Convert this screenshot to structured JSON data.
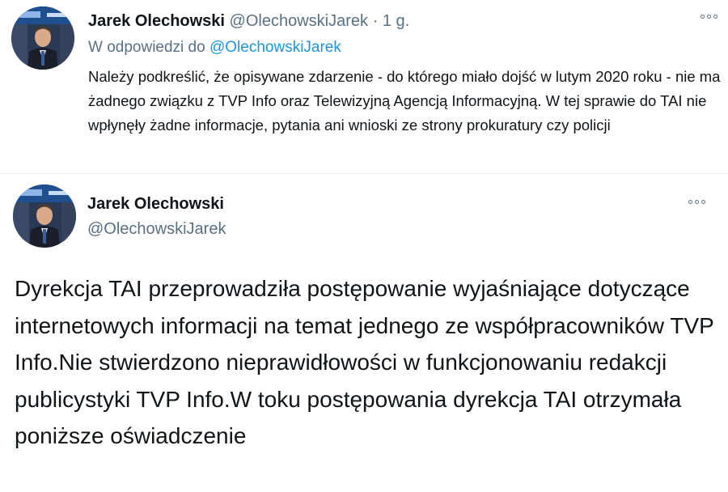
{
  "reply_tweet": {
    "author_name": "Jarek Olechowski",
    "author_handle": "@OlechowskiJarek",
    "separator": "·",
    "time": "1 g.",
    "reply_prefix": "W odpowiedzi do",
    "reply_mention": "@OlechowskiJarek",
    "text": "Należy podkreślić, że opisywane zdarzenie - do którego miało dojść w lutym 2020 roku - nie ma żadnego związku z TVP Info oraz Telewizyjną Agencją Informacyjną. W tej sprawie do TAI nie wpłynęły żadne informacje, pytania ani wnioski ze strony prokuratury czy policji",
    "more_icon": "more-horizontal-icon"
  },
  "main_tweet": {
    "author_name": "Jarek Olechowski",
    "author_handle": "@OlechowskiJarek",
    "text": "Dyrekcja TAI przeprowadziła postępowanie wyjaśniające dotyczące internetowych informacji na temat jednego ze współpracowników TVP Info.Nie stwierdzono nieprawidłowości w funkcjonowaniu redakcji publicystyki TVP Info.W toku postępowania dyrekcja TAI otrzymała poniższe oświadczenie",
    "more_icon": "more-horizontal-icon"
  },
  "colors": {
    "text_primary": "#0f1419",
    "text_secondary": "#5b7083",
    "link": "#1b95e0",
    "divider": "#e6ecf0"
  }
}
